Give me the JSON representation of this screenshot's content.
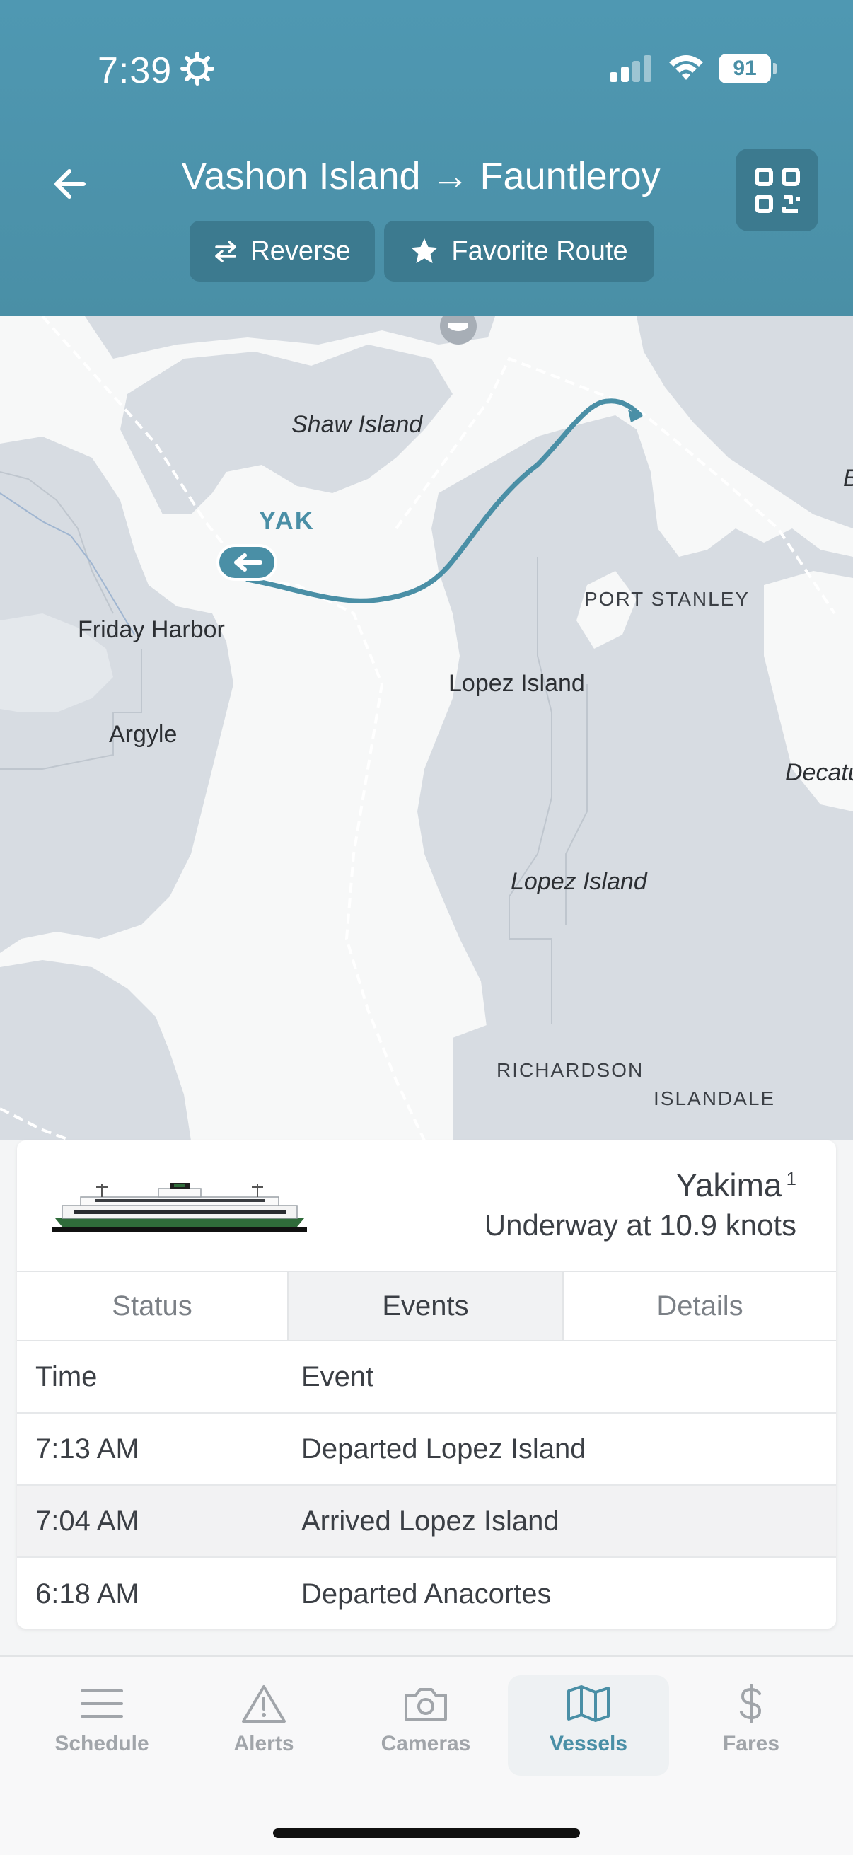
{
  "status_bar": {
    "time": "7:39",
    "battery": "91"
  },
  "header": {
    "title": "Vashon Island → Fauntleroy",
    "reverse_label": "Reverse",
    "favorite_label": "Favorite Route"
  },
  "map": {
    "labels": {
      "shaw_island": "Shaw Island",
      "friday_harbor": "Friday Harbor",
      "argyle": "Argyle",
      "lopez_island_town": "Lopez Island",
      "lopez_island": "Lopez Island",
      "port_stanley": "PORT STANLEY",
      "richardson": "RICHARDSON",
      "islandale": "ISLANDALE",
      "decatur": "Decatu",
      "edge_letter": "B"
    },
    "vessel_code": "YAK"
  },
  "vessel": {
    "name": "Yakima",
    "footnote": "1",
    "status": "Underway at 10.9 knots"
  },
  "tabs": [
    {
      "label": "Status"
    },
    {
      "label": "Events",
      "active": true
    },
    {
      "label": "Details"
    }
  ],
  "events": {
    "headers": {
      "time": "Time",
      "event": "Event"
    },
    "rows": [
      {
        "time": "7:13 AM",
        "event": "Departed Lopez Island"
      },
      {
        "time": "7:04 AM",
        "event": "Arrived Lopez Island"
      },
      {
        "time": "6:18 AM",
        "event": "Departed Anacortes"
      }
    ]
  },
  "nav": [
    {
      "label": "Schedule"
    },
    {
      "label": "Alerts"
    },
    {
      "label": "Cameras"
    },
    {
      "label": "Vessels",
      "active": true
    },
    {
      "label": "Fares"
    }
  ],
  "colors": {
    "accent": "#4a8fa6",
    "header": "#4f98b2",
    "land": "#d7dce2",
    "water": "#f7f8f8"
  }
}
